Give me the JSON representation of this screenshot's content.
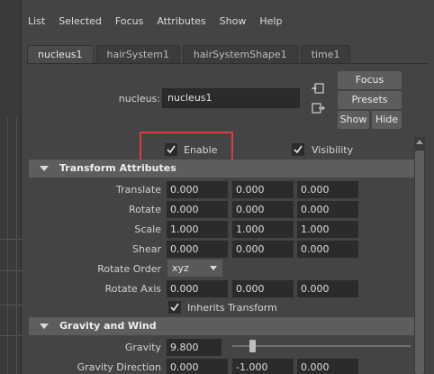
{
  "menu": [
    "List",
    "Selected",
    "Focus",
    "Attributes",
    "Show",
    "Help"
  ],
  "tabs": [
    "nucleus1",
    "hairSystem1",
    "hairSystemShape1",
    "time1"
  ],
  "node": {
    "label": "nucleus:",
    "value": "nucleus1"
  },
  "buttons": {
    "focus": "Focus",
    "presets": "Presets",
    "show": "Show",
    "hide": "Hide"
  },
  "checks": {
    "enable": "Enable",
    "visibility": "Visibility",
    "inherits_transform": "Inherits Transform"
  },
  "sections": {
    "transform": "Transform Attributes",
    "gravity": "Gravity and Wind"
  },
  "transform": {
    "translate": {
      "label": "Translate",
      "values": [
        "0.000",
        "0.000",
        "0.000"
      ]
    },
    "rotate": {
      "label": "Rotate",
      "values": [
        "0.000",
        "0.000",
        "0.000"
      ]
    },
    "scale": {
      "label": "Scale",
      "values": [
        "1.000",
        "1.000",
        "1.000"
      ]
    },
    "shear": {
      "label": "Shear",
      "values": [
        "0.000",
        "0.000",
        "0.000"
      ]
    },
    "rotate_order": {
      "label": "Rotate Order",
      "value": "xyz"
    },
    "rotate_axis": {
      "label": "Rotate Axis",
      "values": [
        "0.000",
        "0.000",
        "0.000"
      ]
    }
  },
  "gravity": {
    "gravity": {
      "label": "Gravity",
      "value": "9.800"
    },
    "direction": {
      "label": "Gravity Direction",
      "values": [
        "0.000",
        "-1.000",
        "0.000"
      ]
    }
  },
  "colors": {
    "highlight": "#e03b3b",
    "field_bg": "#2b2b2b",
    "panel_bg": "#444444"
  }
}
